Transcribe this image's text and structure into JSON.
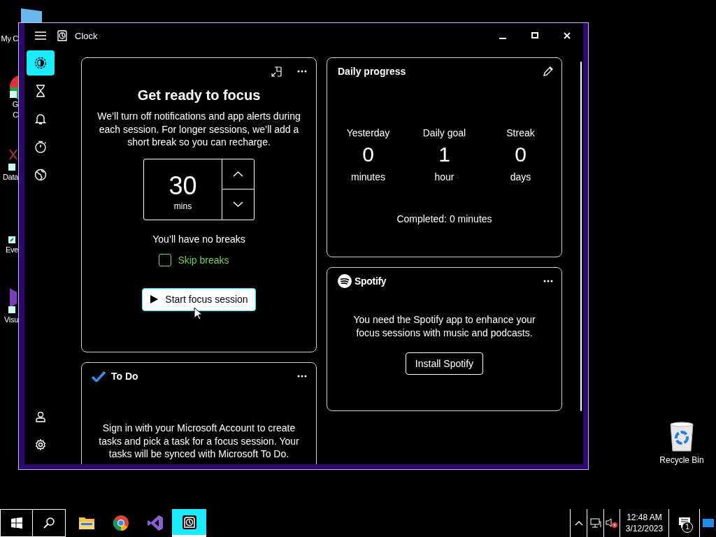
{
  "desktop_icons": [
    {
      "kind": "computer",
      "lines": [
        "My C"
      ]
    },
    {
      "kind": "chrome",
      "lines": [
        "G",
        "C"
      ]
    },
    {
      "kind": "data",
      "lines": [
        "Data"
      ]
    },
    {
      "kind": "shortcut",
      "lines": [
        "Eve"
      ]
    },
    {
      "kind": "studio",
      "lines": [
        "Visu"
      ]
    }
  ],
  "recycle_bin": {
    "label": "Recycle Bin"
  },
  "window": {
    "title": "Clock"
  },
  "sidebar": {
    "items": [
      {
        "kind": "focus",
        "selected": true
      },
      {
        "kind": "timer",
        "selected": false
      },
      {
        "kind": "alarm",
        "selected": false
      },
      {
        "kind": "stopwatch",
        "selected": false
      },
      {
        "kind": "world",
        "selected": false
      }
    ],
    "footer": [
      {
        "kind": "account"
      },
      {
        "kind": "settings"
      }
    ]
  },
  "focus_card": {
    "title": "Get ready to focus",
    "description": "We’ll turn off notifications and app alerts during each session. For longer sessions, we’ll add a short break so you can recharge.",
    "duration": "30",
    "unit": "mins",
    "breaks": "You’ll have no breaks",
    "skip_breaks": {
      "label": "Skip breaks",
      "checked": false
    },
    "start_button": "Start focus session"
  },
  "todo_card": {
    "title": "To Do",
    "message": "Sign in with your Microsoft Account to create tasks and pick a task for a focus session. Your tasks will be synced with Microsoft To Do."
  },
  "daily_progress": {
    "title": "Daily progress",
    "stats": [
      {
        "label": "Yesterday",
        "value": "0",
        "unit": "minutes"
      },
      {
        "label": "Daily goal",
        "value": "1",
        "unit": "hour"
      },
      {
        "label": "Streak",
        "value": "0",
        "unit": "days"
      }
    ],
    "completed": "Completed: 0 minutes"
  },
  "spotify_card": {
    "brand": "Spotify",
    "message": "You need the Spotify app to enhance your focus sessions with music and podcasts.",
    "button": "Install Spotify"
  },
  "taskbar": {
    "apps": [
      {
        "kind": "explorer",
        "selected": false
      },
      {
        "kind": "chrome",
        "selected": false
      },
      {
        "kind": "studio",
        "selected": false
      },
      {
        "kind": "clock",
        "selected": true
      }
    ],
    "time": "12:48 AM",
    "date": "3/12/2023",
    "notification_count": "1"
  }
}
